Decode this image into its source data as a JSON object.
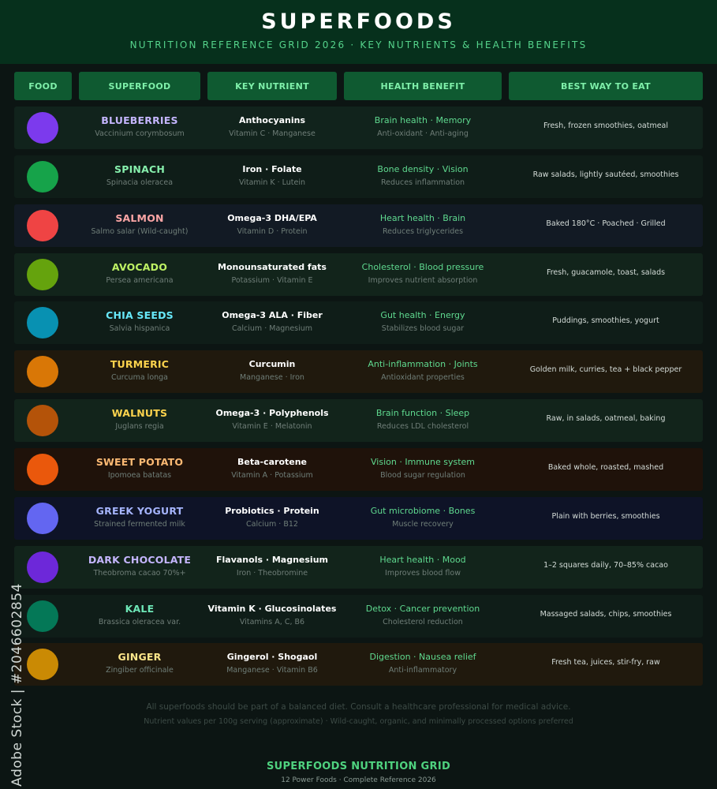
{
  "header": {
    "title": "SUPERFOODS",
    "subtitle": "NUTRITION REFERENCE GRID 2026 · KEY NUTRIENTS & HEALTH BENEFITS"
  },
  "columns": [
    "FOOD",
    "SUPERFOOD",
    "KEY NUTRIENT",
    "HEALTH BENEFIT",
    "BEST WAY TO EAT"
  ],
  "rows": [
    {
      "name": "BLUEBERRIES",
      "latin": "Vaccinium corymbosum",
      "nutrient": "Anthocyanins",
      "nutrient_sub": "Vitamin C · Manganese",
      "benefit": "Brain health · Memory",
      "benefit_sub": "Anti-oxidant · Anti-aging",
      "eat": "Fresh, frozen smoothies, oatmeal",
      "dot_color": "#7c3aed",
      "name_color": "#c4b5fd",
      "row_bg": "#11231c"
    },
    {
      "name": "SPINACH",
      "latin": "Spinacia oleracea",
      "nutrient": "Iron · Folate",
      "nutrient_sub": "Vitamin K · Lutein",
      "benefit": "Bone density · Vision",
      "benefit_sub": "Reduces inflammation",
      "eat": "Raw salads, lightly sautéed, smoothies",
      "dot_color": "#16a34a",
      "name_color": "#86efac",
      "row_bg": "#0f1d18"
    },
    {
      "name": "SALMON",
      "latin": "Salmo salar (Wild-caught)",
      "nutrient": "Omega-3 DHA/EPA",
      "nutrient_sub": "Vitamin D · Protein",
      "benefit": "Heart health · Brain",
      "benefit_sub": "Reduces triglycerides",
      "eat": "Baked 180°C · Poached · Grilled",
      "dot_color": "#ef4444",
      "name_color": "#fca5a5",
      "row_bg": "#121a24"
    },
    {
      "name": "AVOCADO",
      "latin": "Persea americana",
      "nutrient": "Monounsaturated fats",
      "nutrient_sub": "Potassium · Vitamin E",
      "benefit": "Cholesterol · Blood pressure",
      "benefit_sub": "Improves nutrient absorption",
      "eat": "Fresh, guacamole, toast, salads",
      "dot_color": "#65a30d",
      "name_color": "#bef264",
      "row_bg": "#12241b"
    },
    {
      "name": "CHIA SEEDS",
      "latin": "Salvia hispanica",
      "nutrient": "Omega-3 ALA · Fiber",
      "nutrient_sub": "Calcium · Magnesium",
      "benefit": "Gut health · Energy",
      "benefit_sub": "Stabilizes blood sugar",
      "eat": "Puddings, smoothies, yogurt",
      "dot_color": "#0891b2",
      "name_color": "#67e8f9",
      "row_bg": "#0f1d18"
    },
    {
      "name": "TURMERIC",
      "latin": "Curcuma longa",
      "nutrient": "Curcumin",
      "nutrient_sub": "Manganese · Iron",
      "benefit": "Anti-inflammation · Joints",
      "benefit_sub": "Antioxidant properties",
      "eat": "Golden milk, curries, tea + black pepper",
      "dot_color": "#d97706",
      "name_color": "#fcd34d",
      "row_bg": "#20190d"
    },
    {
      "name": "WALNUTS",
      "latin": "Juglans regia",
      "nutrient": "Omega-3 · Polyphenols",
      "nutrient_sub": "Vitamin E · Melatonin",
      "benefit": "Brain function · Sleep",
      "benefit_sub": "Reduces LDL cholesterol",
      "eat": "Raw, in salads, oatmeal, baking",
      "dot_color": "#b45309",
      "name_color": "#fcd34d",
      "row_bg": "#12241b"
    },
    {
      "name": "SWEET POTATO",
      "latin": "Ipomoea batatas",
      "nutrient": "Beta-carotene",
      "nutrient_sub": "Vitamin A · Potassium",
      "benefit": "Vision · Immune system",
      "benefit_sub": "Blood sugar regulation",
      "eat": "Baked whole, roasted, mashed",
      "dot_color": "#ea580c",
      "name_color": "#fdba74",
      "row_bg": "#1f120a"
    },
    {
      "name": "GREEK YOGURT",
      "latin": "Strained fermented milk",
      "nutrient": "Probiotics · Protein",
      "nutrient_sub": "Calcium · B12",
      "benefit": "Gut microbiome · Bones",
      "benefit_sub": "Muscle recovery",
      "eat": "Plain with berries, smoothies",
      "dot_color": "#6366f1",
      "name_color": "#a5b4fc",
      "row_bg": "#0e1327"
    },
    {
      "name": "DARK CHOCOLATE",
      "latin": "Theobroma cacao 70%+",
      "nutrient": "Flavanols · Magnesium",
      "nutrient_sub": "Iron · Theobromine",
      "benefit": "Heart health · Mood",
      "benefit_sub": "Improves blood flow",
      "eat": "1–2 squares daily, 70–85% cacao",
      "dot_color": "#6d28d9",
      "name_color": "#c4b5fd",
      "row_bg": "#12241b"
    },
    {
      "name": "KALE",
      "latin": "Brassica oleracea var.",
      "nutrient": "Vitamin K · Glucosinolates",
      "nutrient_sub": "Vitamins A, C, B6",
      "benefit": "Detox · Cancer prevention",
      "benefit_sub": "Cholesterol reduction",
      "eat": "Massaged salads, chips, smoothies",
      "dot_color": "#047857",
      "name_color": "#6ee7b7",
      "row_bg": "#0f1d18"
    },
    {
      "name": "GINGER",
      "latin": "Zingiber officinale",
      "nutrient": "Gingerol · Shogaol",
      "nutrient_sub": "Manganese · Vitamin B6",
      "benefit": "Digestion · Nausea relief",
      "benefit_sub": "Anti-inflammatory",
      "eat": "Fresh tea, juices, stir-fry, raw",
      "dot_color": "#ca8a04",
      "name_color": "#fde68a",
      "row_bg": "#20190d"
    }
  ],
  "notes": {
    "line1": "All superfoods should be part of a balanced diet. Consult a healthcare professional for medical advice.",
    "line2": "Nutrient values per 100g serving (approximate) · Wild-caught, organic, and minimally processed options preferred"
  },
  "footer": {
    "title": "SUPERFOODS NUTRITION GRID",
    "subtitle": "12 Power Foods · Complete Reference 2026"
  },
  "watermark": "Adobe Stock | #2046602854"
}
